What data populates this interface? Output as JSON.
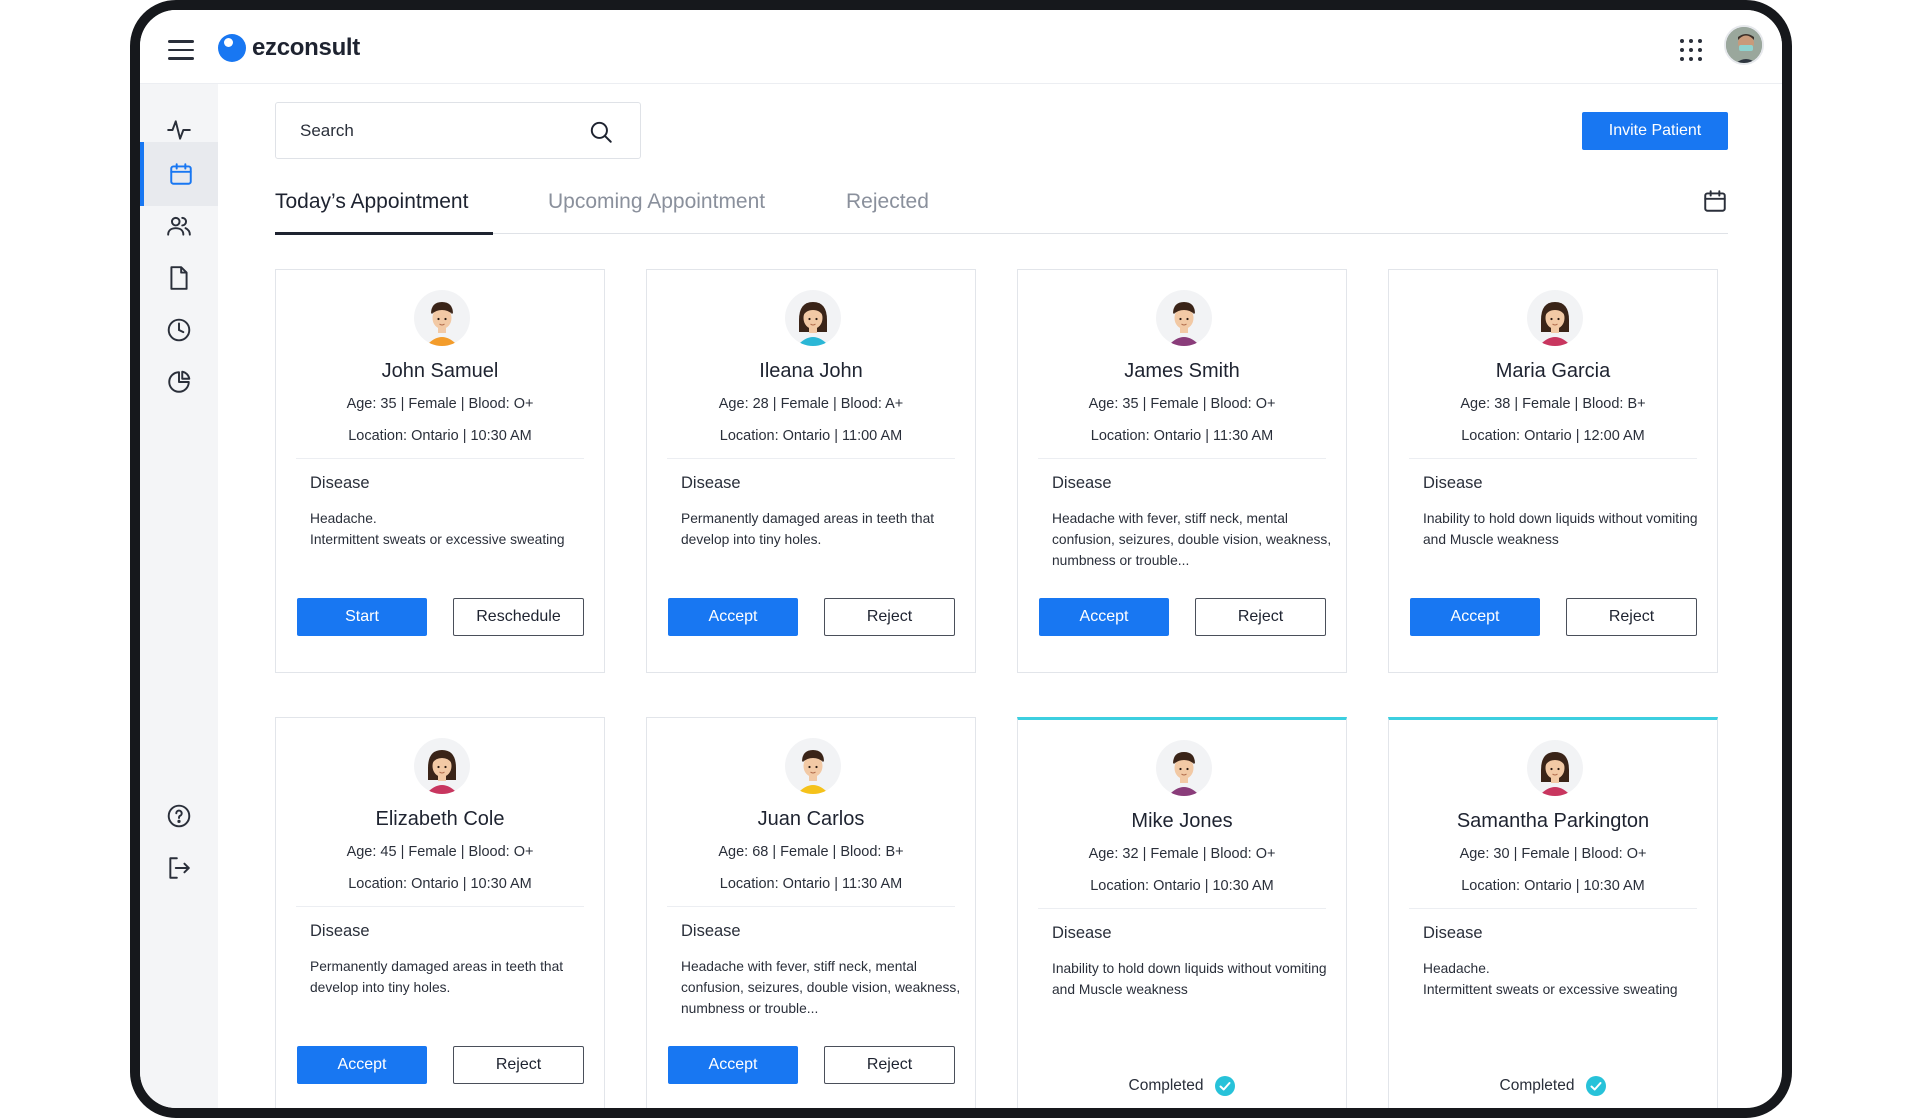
{
  "app": {
    "logo_text": "ezconsult",
    "brand_color": "#1877f2"
  },
  "topbar": {
    "menu_icon": "hamburger-icon",
    "apps_icon": "apps-grid-icon",
    "avatar": "user-avatar"
  },
  "sidebar": {
    "items": [
      {
        "name": "activity",
        "icon": "activity-icon",
        "active": false
      },
      {
        "name": "calendar",
        "icon": "calendar-icon",
        "active": true
      },
      {
        "name": "patients",
        "icon": "users-icon",
        "active": false
      },
      {
        "name": "documents",
        "icon": "document-icon",
        "active": false
      },
      {
        "name": "history",
        "icon": "clock-icon",
        "active": false
      },
      {
        "name": "reports",
        "icon": "pie-chart-icon",
        "active": false
      },
      {
        "name": "help",
        "icon": "help-icon",
        "active": false
      },
      {
        "name": "logout",
        "icon": "logout-icon",
        "active": false
      }
    ]
  },
  "search": {
    "placeholder": "Search"
  },
  "invite_label": "Invite Patient",
  "tabs": [
    {
      "label": "Today’s Appointment",
      "active": true
    },
    {
      "label": "Upcoming Appointment",
      "active": false
    },
    {
      "label": "Rejected",
      "active": false
    }
  ],
  "disease_label": "Disease",
  "completed_label": "Completed",
  "cards": [
    {
      "name": "John Samuel",
      "info": "Age: 35 | Female | Blood: O+",
      "location": "Location: Ontario | 10:30 AM",
      "disease": [
        "Headache.",
        "Intermittent sweats or excessive sweating"
      ],
      "primary": "Start",
      "secondary": "Reschedule",
      "status": "pending"
    },
    {
      "name": "Ileana John",
      "info": "Age: 28 | Female | Blood: A+",
      "location": "Location: Ontario | 11:00 AM",
      "disease": [
        "Permanently damaged areas in teeth that develop into tiny holes."
      ],
      "primary": "Accept",
      "secondary": "Reject",
      "status": "pending"
    },
    {
      "name": "James Smith",
      "info": "Age: 35 | Female | Blood: O+",
      "location": "Location: Ontario | 11:30 AM",
      "disease": [
        "Headache with fever, stiff neck, mental confusion, seizures, double vision, weakness, numbness or trouble..."
      ],
      "primary": "Accept",
      "secondary": "Reject",
      "status": "pending"
    },
    {
      "name": "Maria Garcia",
      "info": "Age: 38 | Female | Blood: B+",
      "location": "Location: Ontario | 12:00 AM",
      "disease": [
        "Inability to hold down liquids without vomiting and Muscle weakness"
      ],
      "primary": "Accept",
      "secondary": "Reject",
      "status": "pending"
    },
    {
      "name": "Elizabeth Cole",
      "info": "Age: 45 | Female | Blood: O+",
      "location": "Location: Ontario | 10:30 AM",
      "disease": [
        "Permanently damaged areas in teeth that develop into tiny holes."
      ],
      "primary": "Accept",
      "secondary": "Reject",
      "status": "pending"
    },
    {
      "name": "Juan Carlos",
      "info": "Age: 68 | Female | Blood: B+",
      "location": "Location: Ontario | 11:30 AM",
      "disease": [
        "Headache with fever, stiff neck, mental confusion, seizures, double vision, weakness, numbness or trouble..."
      ],
      "primary": "Accept",
      "secondary": "Reject",
      "status": "pending"
    },
    {
      "name": "Mike Jones",
      "info": "Age: 32 | Female | Blood: O+",
      "location": "Location: Ontario | 10:30 AM",
      "disease": [
        "Inability to hold down liquids without vomiting and Muscle weakness"
      ],
      "status": "completed"
    },
    {
      "name": "Samantha Parkington",
      "info": "Age: 30 | Female | Blood: O+",
      "location": "Location: Ontario | 10:30 AM",
      "disease": [
        "Headache.",
        "Intermittent sweats or excessive sweating"
      ],
      "status": "completed"
    }
  ]
}
